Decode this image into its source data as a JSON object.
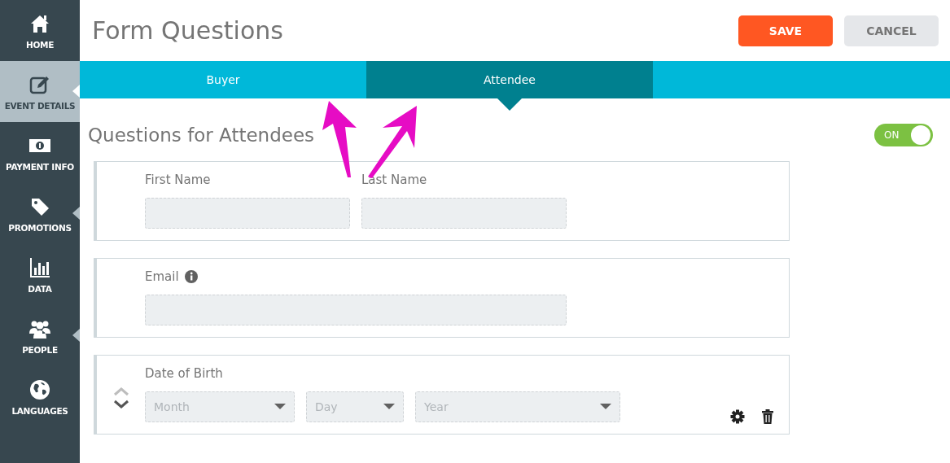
{
  "sidebar": {
    "items": [
      {
        "label": "HOME",
        "selected": false,
        "submenu": false
      },
      {
        "label": "EVENT DETAILS",
        "selected": true,
        "submenu": true
      },
      {
        "label": "PAYMENT INFO",
        "selected": false,
        "submenu": false
      },
      {
        "label": "PROMOTIONS",
        "selected": false,
        "submenu": true
      },
      {
        "label": "DATA",
        "selected": false,
        "submenu": false
      },
      {
        "label": "PEOPLE",
        "selected": false,
        "submenu": true
      },
      {
        "label": "LANGUAGES",
        "selected": false,
        "submenu": false
      }
    ]
  },
  "header": {
    "title": "Form Questions",
    "buttons": [
      {
        "label": "SAVE",
        "kind": "primary"
      },
      {
        "label": "CANCEL",
        "kind": "secondary"
      }
    ]
  },
  "tabs": [
    {
      "label": "Buyer",
      "selected": false
    },
    {
      "label": "Attendee",
      "selected": true
    }
  ],
  "section": {
    "title": "Questions for Attendees",
    "toggle": {
      "label": "ON",
      "on": true
    }
  },
  "questions": [
    {
      "kind": "text",
      "fields": [
        {
          "label": "First Name"
        },
        {
          "label": "Last Name"
        }
      ]
    },
    {
      "kind": "text",
      "fields": [
        {
          "label": "Email",
          "info": true
        }
      ]
    },
    {
      "kind": "dropdowns",
      "label": "Date of Birth",
      "controls": true,
      "dropdowns": [
        {
          "placeholder": "Month"
        },
        {
          "placeholder": "Day"
        },
        {
          "placeholder": "Year"
        }
      ]
    }
  ]
}
